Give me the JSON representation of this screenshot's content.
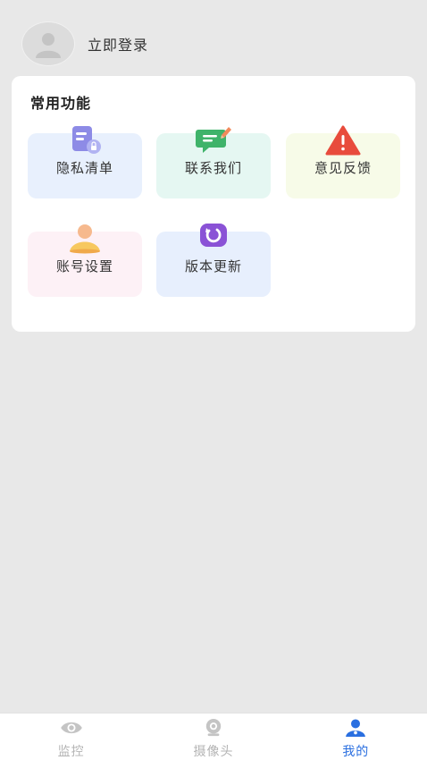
{
  "profile": {
    "login_label": "立即登录"
  },
  "functions": {
    "title": "常用功能",
    "items": [
      {
        "label": "隐私清单",
        "icon": "privacy-list-icon",
        "bg": "#e8f0fd"
      },
      {
        "label": "联系我们",
        "icon": "contact-chat-icon",
        "bg": "#e5f7f2"
      },
      {
        "label": "意见反馈",
        "icon": "warning-triangle-icon",
        "bg": "#f7fbe8"
      },
      {
        "label": "账号设置",
        "icon": "account-user-icon",
        "bg": "#fdf1f6"
      },
      {
        "label": "版本更新",
        "icon": "refresh-update-icon",
        "bg": "#e7effd"
      }
    ]
  },
  "tabs": [
    {
      "label": "监控",
      "icon": "eye-icon",
      "active": false
    },
    {
      "label": "摄像头",
      "icon": "camera-icon",
      "active": false
    },
    {
      "label": "我的",
      "icon": "user-profile-icon",
      "active": true
    }
  ],
  "colors": {
    "accent": "#2a6fe0",
    "inactive": "#b3b3b3",
    "background": "#e8e8e8"
  }
}
